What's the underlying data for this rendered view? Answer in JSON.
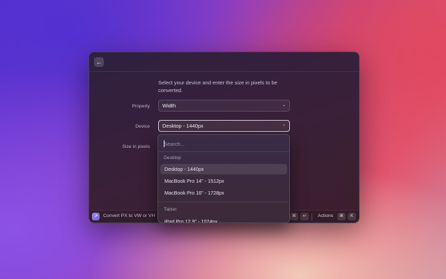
{
  "header": {
    "back_icon": "arrow-left-icon",
    "back_glyph": "←"
  },
  "intro_text": "Select your device and enter the size in pixels to be converted.",
  "form": {
    "property": {
      "label": "Property",
      "value": "Width"
    },
    "device": {
      "label": "Device",
      "value": "Desktop - 1440px"
    },
    "size": {
      "label": "Size in pixels"
    },
    "chevron_down": "⌄",
    "chevron_up": "⌃"
  },
  "dropdown": {
    "search_placeholder": "Search...",
    "sections": [
      {
        "title": "Desktop",
        "items": [
          {
            "label": "Desktop - 1440px",
            "selected": true
          },
          {
            "label": "MacBook Pro 14\" - 1512px",
            "selected": false
          },
          {
            "label": "MacBook Pro 16\" - 1728px",
            "selected": false
          }
        ]
      },
      {
        "title": "Tablet",
        "items": [
          {
            "label": "iPad Pro 12.9\" - 1024px",
            "selected": false
          }
        ]
      }
    ]
  },
  "footer": {
    "extension_name": "Convert PX to VW or VH",
    "primary_shortcut": [
      "⌘",
      "↵"
    ],
    "actions_label": "Actions",
    "actions_shortcut": [
      "⌘",
      "K"
    ]
  }
}
